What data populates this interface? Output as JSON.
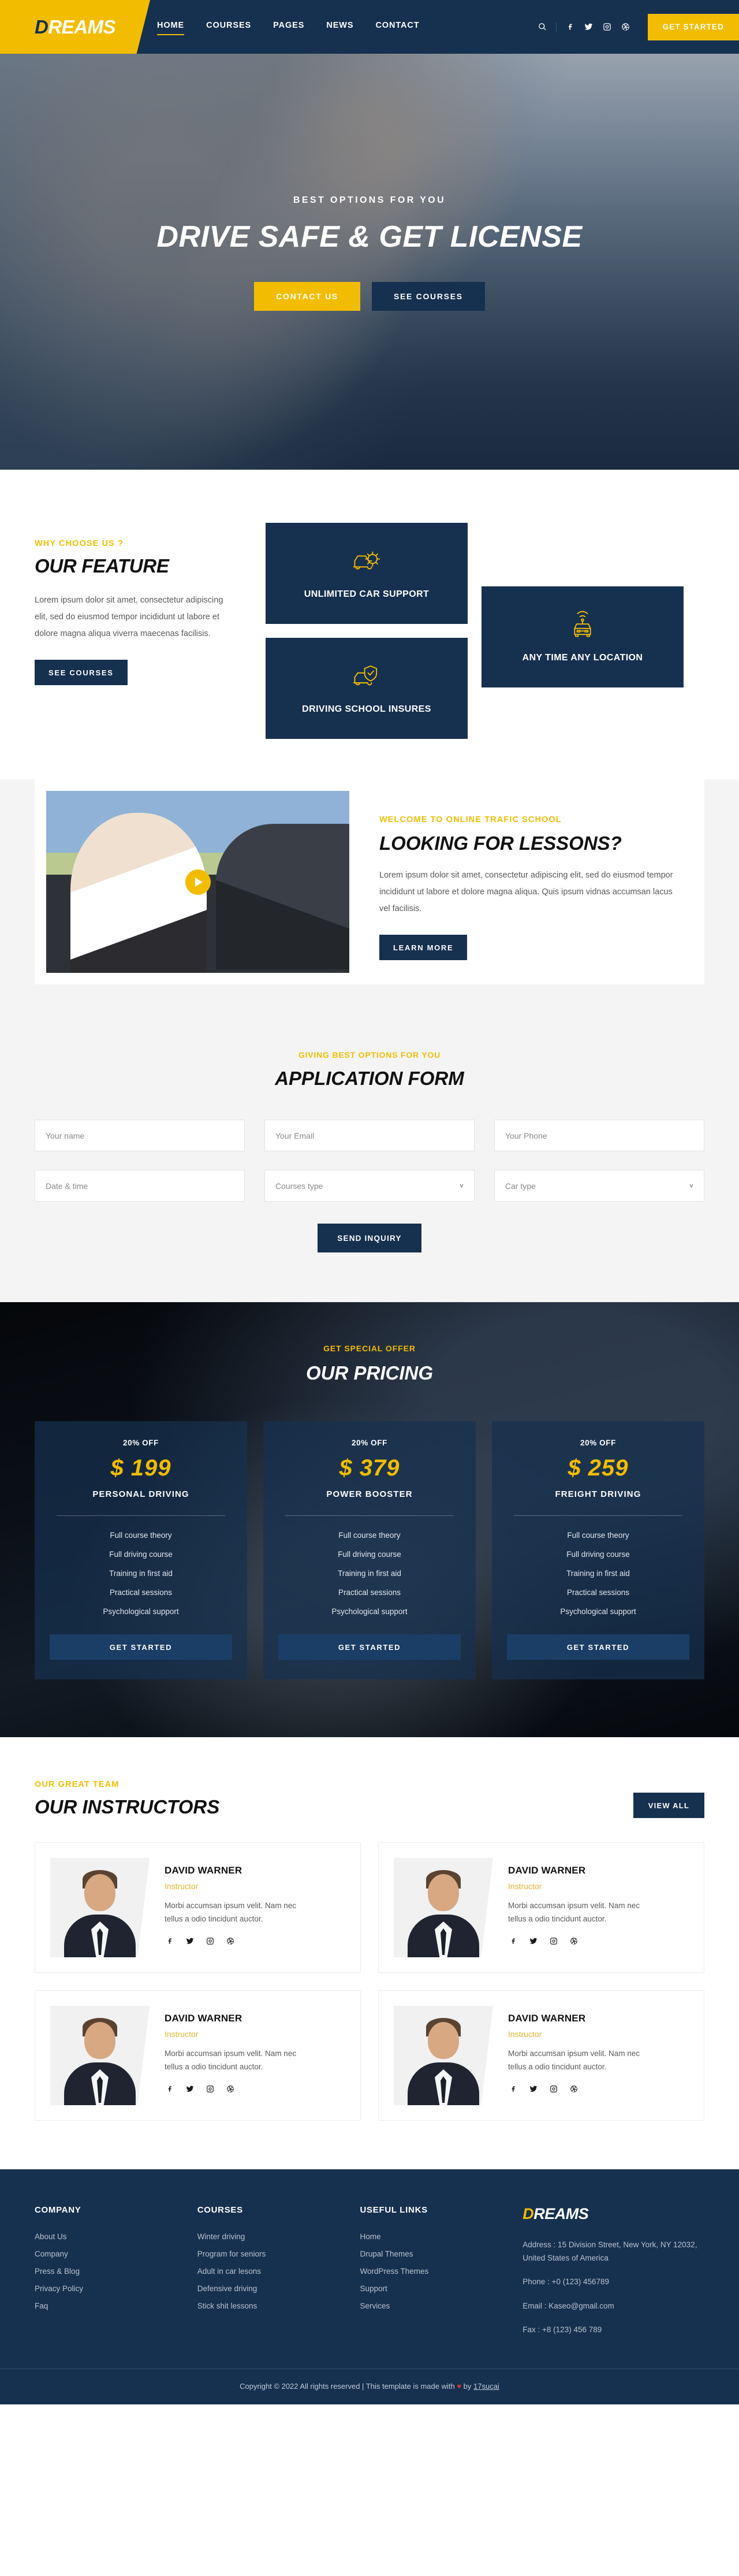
{
  "brand": {
    "name_lead": "D",
    "name_rest": "REAMS"
  },
  "header": {
    "nav": [
      {
        "label": "HOME",
        "active": true
      },
      {
        "label": "COURSES",
        "active": false
      },
      {
        "label": "PAGES",
        "active": false
      },
      {
        "label": "NEWS",
        "active": false
      },
      {
        "label": "CONTACT",
        "active": false
      }
    ],
    "icons": [
      "search-icon",
      "facebook-icon",
      "twitter-icon",
      "instagram-icon",
      "dribbble-icon"
    ],
    "cta_label": "GET STARTED",
    "accent": "#f2bd00",
    "navy": "#16304f"
  },
  "hero": {
    "kicker": "BEST OPTIONS FOR YOU",
    "title": "DRIVE SAFE & GET LICENSE",
    "primary_button": "CONTACT US",
    "secondary_button": "SEE COURSES"
  },
  "features": {
    "kicker": "WHY CHOOSE US ?",
    "title": "OUR FEATURE",
    "text": "Lorem ipsum dolor sit amet, consectetur adipiscing elit, sed do eiusmod tempor incididunt ut labore et dolore magna aliqua viverra maecenas facilisis.",
    "button": "SEE COURSES",
    "cards": [
      {
        "label": "UNLIMITED CAR SUPPORT",
        "icon": "car-gear-icon"
      },
      {
        "label": "DRIVING SCHOOL INSURES",
        "icon": "car-shield-icon"
      },
      {
        "label": "ANY TIME ANY LOCATION",
        "icon": "car-signal-icon"
      }
    ]
  },
  "lessons": {
    "kicker": "WELCOME TO ONLINE TRAFIC SCHOOL",
    "title": "LOOKING FOR LESSONS?",
    "text": "Lorem ipsum dolor sit amet, consectetur adipiscing elit, sed do eiusmod tempor incididunt ut labore et dolore magna aliqua. Quis ipsum vidnas accumsan lacus vel facilisis.",
    "button": "LEARN MORE",
    "play_icon": "play-icon"
  },
  "form": {
    "kicker": "GIVING BEST OPTIONS FOR YOU",
    "title": "APPLICATION FORM",
    "fields": [
      {
        "placeholder": "Your name",
        "type": "text"
      },
      {
        "placeholder": "Your Email",
        "type": "text"
      },
      {
        "placeholder": "Your Phone",
        "type": "text"
      },
      {
        "placeholder": "Date & time",
        "type": "text"
      },
      {
        "placeholder": "Courses type",
        "type": "select"
      },
      {
        "placeholder": "Car type",
        "type": "select"
      }
    ],
    "submit": "SEND INQUIRY"
  },
  "pricing": {
    "kicker": "GET SPECIAL OFFER",
    "title": "OUR PRICING",
    "cards": [
      {
        "off": "20% OFF",
        "amount": "$ 199",
        "plan": "PERSONAL DRIVING",
        "features": [
          "Full course theory",
          "Full driving course",
          "Training in first aid",
          "Practical sessions",
          "Psychological support"
        ],
        "cta": "GET STARTED"
      },
      {
        "off": "20% OFF",
        "amount": "$ 379",
        "plan": "POWER BOOSTER",
        "features": [
          "Full course theory",
          "Full driving course",
          "Training in first aid",
          "Practical sessions",
          "Psychological support"
        ],
        "cta": "GET STARTED"
      },
      {
        "off": "20% OFF",
        "amount": "$ 259",
        "plan": "FREIGHT DRIVING",
        "features": [
          "Full course theory",
          "Full driving course",
          "Training in first aid",
          "Practical sessions",
          "Psychological support"
        ],
        "cta": "GET STARTED"
      }
    ]
  },
  "instructors": {
    "kicker": "OUR GREAT TEAM",
    "title": "OUR INSTRUCTORS",
    "view_all": "VIEW ALL",
    "cards": [
      {
        "name": "DAVID WARNER",
        "role": "Instructor",
        "bio": "Morbi accumsan ipsum velit. Nam nec tellus a odio tincidunt auctor."
      },
      {
        "name": "DAVID WARNER",
        "role": "Instructor",
        "bio": "Morbi accumsan ipsum velit. Nam nec tellus a odio tincidunt auctor."
      },
      {
        "name": "DAVID WARNER",
        "role": "Instructor",
        "bio": "Morbi accumsan ipsum velit. Nam nec tellus a odio tincidunt auctor."
      },
      {
        "name": "DAVID WARNER",
        "role": "Instructor",
        "bio": "Morbi accumsan ipsum velit. Nam nec tellus a odio tincidunt auctor."
      }
    ],
    "social": [
      "facebook-icon",
      "twitter-icon",
      "instagram-icon",
      "dribbble-icon"
    ]
  },
  "footer": {
    "col1": {
      "head": "COMPANY",
      "items": [
        "About Us",
        "Company",
        "Press & Blog",
        "Privacy Policy",
        "Faq"
      ]
    },
    "col2": {
      "head": "COURSES",
      "items": [
        "Winter driving",
        "Program for seniors",
        "Adult in car lesons",
        "Defensive driving",
        "Stick shit lessons"
      ]
    },
    "col3": {
      "head": "USEFUL LINKS",
      "items": [
        "Home",
        "Drupal Themes",
        "WordPress Themes",
        "Support",
        "Services"
      ]
    },
    "contact": {
      "address": "Address : 15 Division Street, New York, NY 12032, United States of America",
      "phone": "Phone : +0 (123) 456789",
      "email": "Email : Kaseo@gmail.com",
      "fax": "Fax : +8 (123) 456 789"
    },
    "copyright_pre": "Copyright © 2022 All rights reserved | This template is made with ",
    "copyright_heart": "♥",
    "copyright_mid": " by ",
    "copyright_link": "17sucai"
  }
}
